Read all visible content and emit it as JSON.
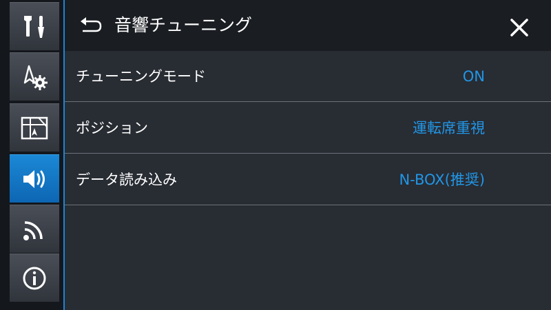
{
  "header": {
    "title": "音響チューニング",
    "back_icon": "back-arrow-icon",
    "close_icon": "close-icon"
  },
  "sidebar": {
    "items": [
      {
        "icon": "tools-icon",
        "active": false
      },
      {
        "icon": "navigation-settings-icon",
        "active": false
      },
      {
        "icon": "map-icon",
        "active": false
      },
      {
        "icon": "speaker-icon",
        "active": true
      },
      {
        "icon": "wireless-icon",
        "active": false
      },
      {
        "icon": "info-icon",
        "active": false
      }
    ]
  },
  "settings": [
    {
      "label": "チューニングモード",
      "value": "ON"
    },
    {
      "label": "ポジション",
      "value": "運転席重視"
    },
    {
      "label": "データ読み込み",
      "value": "N-BOX(推奨)"
    }
  ],
  "colors": {
    "accent": "#1c86d3",
    "value_text": "#2196e6",
    "background": "#282c33",
    "header": "#1a1d22"
  }
}
